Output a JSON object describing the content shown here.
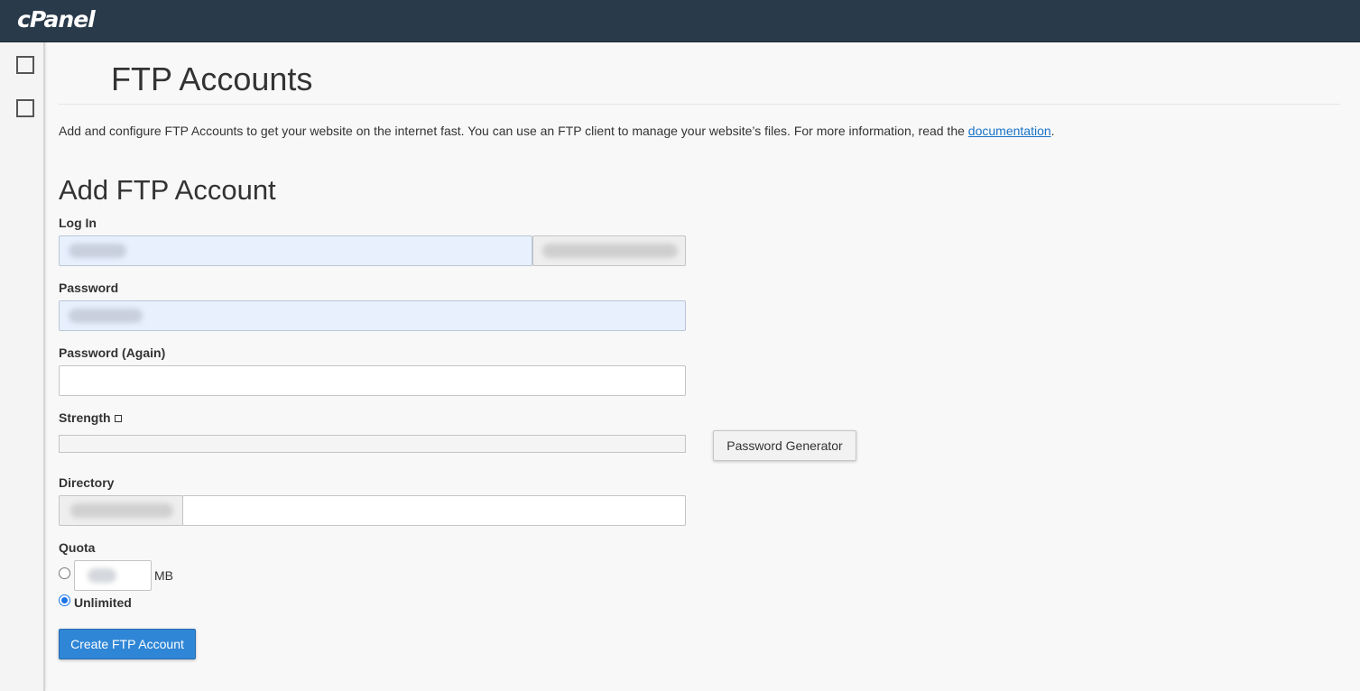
{
  "header": {
    "logo_text": "cPanel"
  },
  "sidebar": {
    "icons": [
      "square-icon",
      "square-icon"
    ]
  },
  "page": {
    "title": "FTP Accounts",
    "description_prefix": "Add and configure FTP Accounts to get your website on the internet fast. You can use an FTP client to manage your website’s files. For more information, read the ",
    "description_link": "documentation",
    "description_suffix": "."
  },
  "form": {
    "section_title": "Add FTP Account",
    "login_label": "Log In",
    "password_label": "Password",
    "password_again_label": "Password (Again)",
    "strength_label": "Strength",
    "password_generator_label": "Password Generator",
    "directory_label": "Directory",
    "quota_label": "Quota",
    "quota_unit": "MB",
    "unlimited_label": "Unlimited",
    "quota_selected": "Unlimited",
    "submit_label": "Create FTP Account"
  },
  "colors": {
    "topbar": "#293a4a",
    "primary_button": "#2f86d6",
    "link": "#1a73c9",
    "autofill": "#e8f0fe"
  }
}
